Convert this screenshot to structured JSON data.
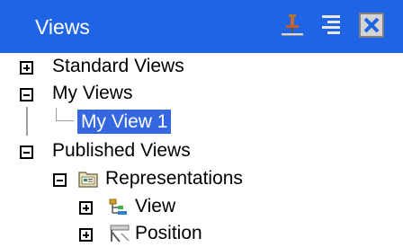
{
  "window": {
    "title": "Views",
    "buttons": [
      {
        "name": "pin-icon",
        "role": "pin"
      },
      {
        "name": "list-icon",
        "role": "menu"
      },
      {
        "name": "close-icon",
        "role": "close"
      }
    ]
  },
  "colors": {
    "titlebar": "#1e64e4",
    "selection": "#3467e0"
  },
  "tree": {
    "standard": {
      "label": "Standard Views",
      "state": "collapsed"
    },
    "my": {
      "label": "My Views",
      "state": "expanded",
      "children": [
        {
          "label": "My View 1",
          "selected": true
        }
      ]
    },
    "published": {
      "label": "Published Views",
      "state": "expanded",
      "representations": {
        "label": "Representations",
        "state": "expanded",
        "icon": "folder-icon",
        "children": [
          {
            "label": "View",
            "state": "collapsed",
            "icon": "hierarchy-icon"
          },
          {
            "label": "Position",
            "state": "collapsed",
            "icon": "position-icon"
          }
        ]
      }
    }
  }
}
